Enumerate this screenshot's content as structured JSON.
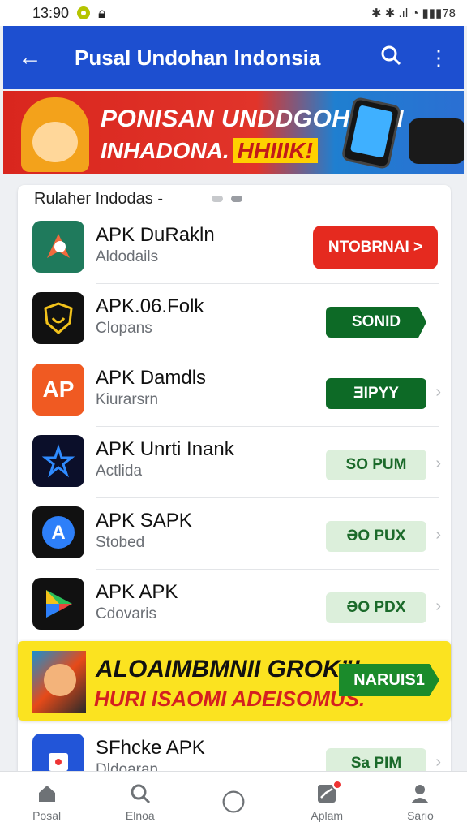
{
  "status_bar": {
    "time": "13:90",
    "right_text": "✱ ✱ .ıl ◔ ▮▮▮78"
  },
  "app_bar": {
    "title": "Pusal Undohan Indonsia"
  },
  "top_banner": {
    "line1": "PONISAN UNDDGOHHAN",
    "line2": "INHADONA.",
    "tag": "HHIIIK!"
  },
  "list": {
    "header": "Rulaher Indodas -",
    "items": [
      {
        "name": "APK DuRakln",
        "subtitle": "Aldodails",
        "button": "NTOBRNAI >",
        "button_style": "red",
        "icon": "rocket-icon",
        "icon_color": "#1f7a5c"
      },
      {
        "name": "APK.06.Folk",
        "subtitle": "Clopans",
        "button": "SONID",
        "button_style": "green",
        "icon": "shield-icon",
        "icon_color": "#111111"
      },
      {
        "name": "APK Damdls",
        "subtitle": "Kiurarsrn",
        "button": "ƎIPYY",
        "button_style": "green",
        "icon": "ap-icon",
        "icon_color": "#f05a22"
      },
      {
        "name": "APK Unrti Inank",
        "subtitle": "Actlida",
        "button": "SO PUM",
        "button_style": "light",
        "icon": "star-icon",
        "icon_color": "#0b0f2a"
      },
      {
        "name": "APK SAPK",
        "subtitle": "Stobed",
        "button": "ƏO PUX",
        "button_style": "light",
        "icon": "store-icon",
        "icon_color": "#111111"
      },
      {
        "name": "APK APK",
        "subtitle": "Cdovaris",
        "button": "ƏO PDX",
        "button_style": "light",
        "icon": "play-icon",
        "icon_color": "#111111"
      }
    ],
    "last_item": {
      "name": "SFhcke APK",
      "subtitle": "Dldoaran",
      "button": "Sa PIM"
    }
  },
  "promo": {
    "line1": "ALOAIMBMNII GROK”!",
    "line2": "HURI ISAOMI ADEISOMUS.",
    "button": "NARUIS1"
  },
  "bottom_nav": [
    {
      "label": "Posal",
      "icon": "home-icon"
    },
    {
      "label": "Elnoa",
      "icon": "search-icon"
    },
    {
      "label": "",
      "icon": "circle-icon"
    },
    {
      "label": "Aplam",
      "icon": "chart-icon"
    },
    {
      "label": "Sario",
      "icon": "profile-icon"
    }
  ],
  "colors": {
    "primary": "#1d4fd0",
    "accent_red": "#e52a1f",
    "accent_green": "#0d6a26",
    "promo_yellow": "#fbe320"
  }
}
